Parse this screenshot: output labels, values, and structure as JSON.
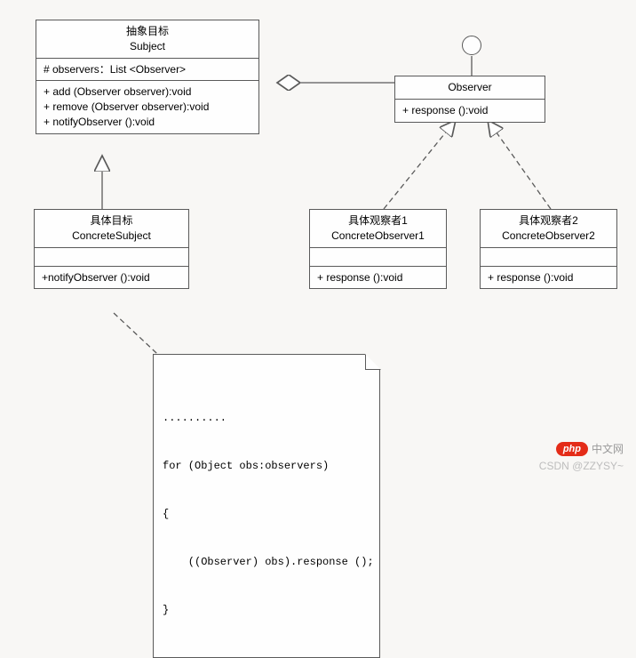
{
  "classes": {
    "subject": {
      "title_zh": "抽象目标",
      "title_en": "Subject",
      "attrs": [
        "# observers：List <Observer>"
      ],
      "ops": [
        "+ add (Observer observer):void",
        "+ remove (Observer observer):void",
        "+ notifyObserver ():void"
      ]
    },
    "observer": {
      "title": "Observer",
      "ops": [
        "+ response ():void"
      ]
    },
    "concreteSubject": {
      "title_zh": "具体目标",
      "title_en": "ConcreteSubject",
      "ops": [
        "+notifyObserver ():void"
      ]
    },
    "concreteObserver1": {
      "title_zh": "具体观察者1",
      "title_en": "ConcreteObserver1",
      "ops": [
        "+ response ():void"
      ]
    },
    "concreteObserver2": {
      "title_zh": "具体观察者2",
      "title_en": "ConcreteObserver2",
      "ops": [
        "+ response ():void"
      ]
    }
  },
  "note": {
    "line1": "..........",
    "line2": "for (Object obs:observers)",
    "line3": "{",
    "line4": "    ((Observer) obs).response ();",
    "line5": "}"
  },
  "watermarks": {
    "php_text": "php",
    "zhongwen": "中文网",
    "csdn": "CSDN @ZZYSY~"
  }
}
